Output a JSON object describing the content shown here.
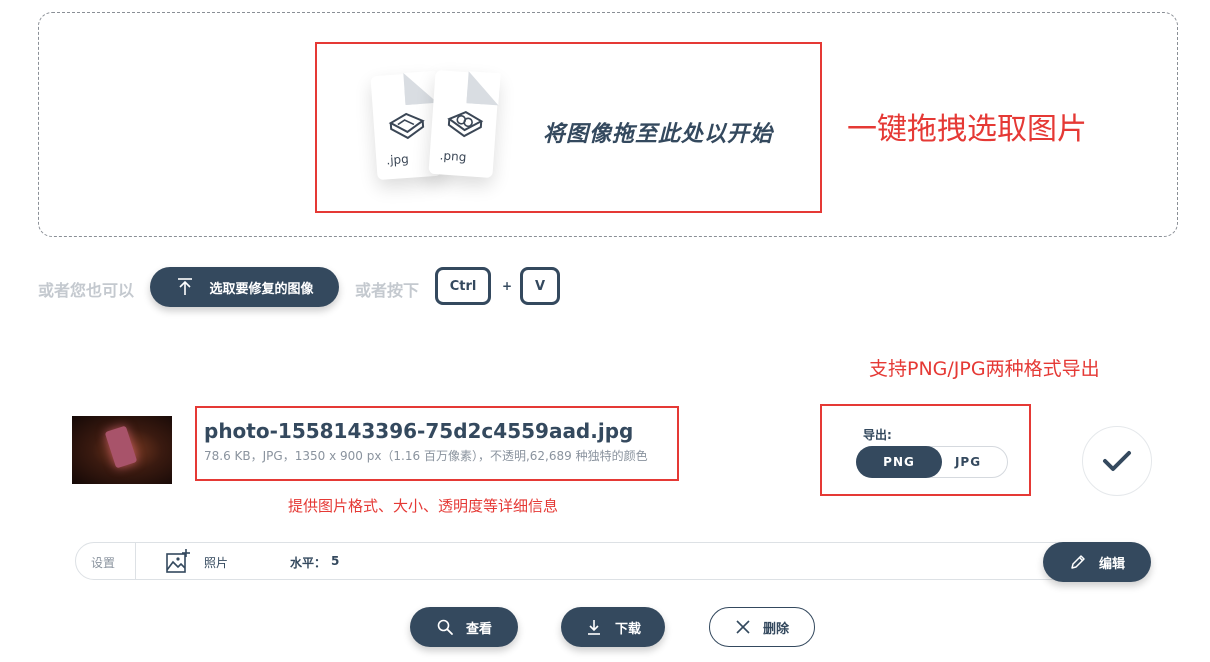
{
  "dropzone": {
    "prompt": "将图像拖至此处以开始",
    "file_icons": [
      {
        "ext": ".jpg",
        "icon": "image-file-icon"
      },
      {
        "ext": ".png",
        "icon": "image-file-icon"
      }
    ]
  },
  "annotations": {
    "drag_drop": "一键拖拽选取图片",
    "formats": "支持PNG/JPG两种格式导出",
    "info": "提供图片格式、大小、透明度等详细信息"
  },
  "select_row": {
    "or_you_can": "或者您也可以",
    "select_button": "选取要修复的图像",
    "or_press": "或者按下",
    "key_ctrl": "Ctrl",
    "plus": "+",
    "key_v": "V"
  },
  "file": {
    "name": "photo-1558143396-75d2c4559aad.jpg",
    "meta": "78.6 KB，JPG，1350 x 900 px（1.16 百万像素），不透明,62,689 种独特的颜色"
  },
  "export": {
    "label": "导出:",
    "options": [
      "PNG",
      "JPG"
    ],
    "selected": "PNG"
  },
  "settings": {
    "label": "设置",
    "mode": "照片",
    "level_label": "水平：",
    "level_value": "5",
    "edit_button": "编辑"
  },
  "actions": {
    "view": "查看",
    "download": "下载",
    "delete": "删除"
  },
  "colors": {
    "primary": "#34495e",
    "annotation": "#e53935",
    "muted": "#c4c9cf"
  }
}
